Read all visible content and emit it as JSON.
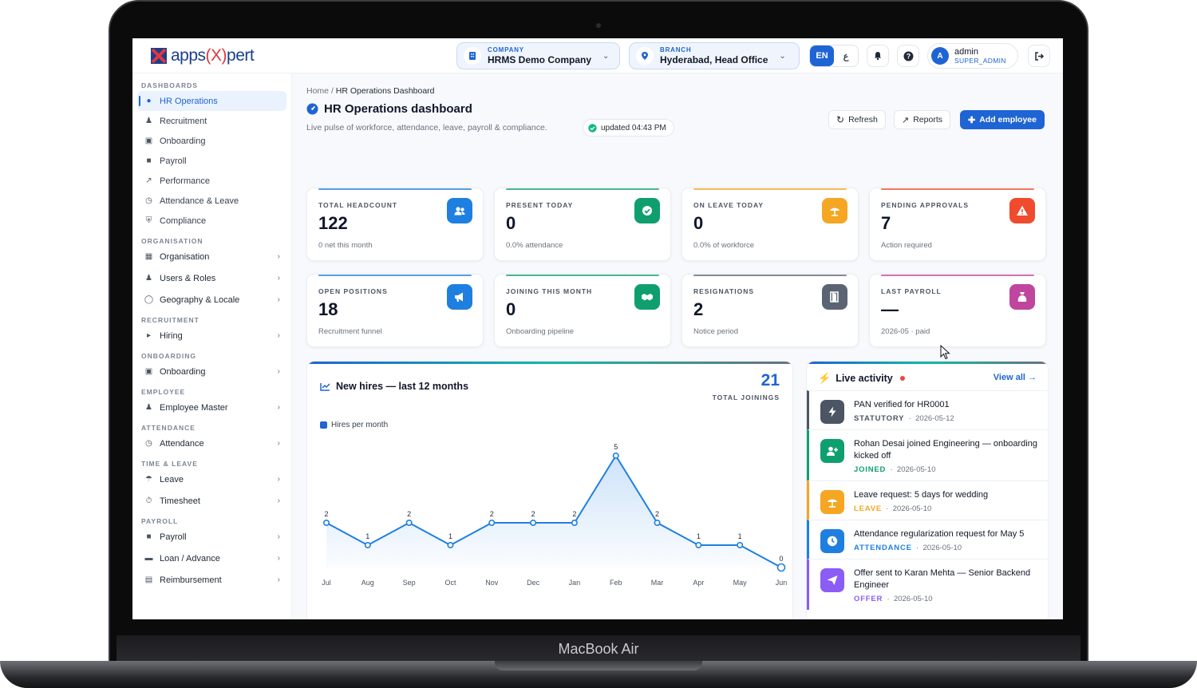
{
  "device": {
    "label": "MacBook Air"
  },
  "header": {
    "logo": {
      "prefix": "apps",
      "mark": "(X)",
      "suffix": "pert"
    },
    "company": {
      "caption": "COMPANY",
      "value": "HRMS Demo Company"
    },
    "branch": {
      "caption": "BRANCH",
      "value": "Hyderabad, Head Office"
    },
    "lang": {
      "active": "EN",
      "other": "ع"
    },
    "user": {
      "initial": "A",
      "name": "admin",
      "role": "SUPER_ADMIN"
    }
  },
  "sidebar": {
    "dashboards": {
      "title": "DASHBOARDS",
      "items": [
        "HR Operations",
        "Recruitment",
        "Onboarding",
        "Payroll",
        "Performance",
        "Attendance & Leave",
        "Compliance"
      ]
    },
    "organisation": {
      "title": "ORGANISATION",
      "items": [
        "Organisation",
        "Users & Roles",
        "Geography & Locale"
      ]
    },
    "recruitment": {
      "title": "RECRUITMENT",
      "items": [
        "Hiring"
      ]
    },
    "onboarding": {
      "title": "ONBOARDING",
      "items": [
        "Onboarding"
      ]
    },
    "employee": {
      "title": "EMPLOYEE",
      "items": [
        "Employee Master"
      ]
    },
    "attendance": {
      "title": "ATTENDANCE",
      "items": [
        "Attendance"
      ]
    },
    "time_leave": {
      "title": "TIME & LEAVE",
      "items": [
        "Leave",
        "Timesheet"
      ]
    },
    "payroll": {
      "title": "PAYROLL",
      "items": [
        "Payroll",
        "Loan / Advance",
        "Reimbursement"
      ]
    }
  },
  "main": {
    "breadcrumb": {
      "home": "Home",
      "sep": "/",
      "current": "HR Operations Dashboard"
    },
    "title": "HR Operations dashboard",
    "subtitle": "Live pulse of workforce, attendance, leave, payroll & compliance.",
    "updated": "updated 04:43 PM",
    "buttons": {
      "refresh": "Refresh",
      "reports": "Reports",
      "add": "Add employee"
    },
    "kpis": [
      {
        "label": "TOTAL HEADCOUNT",
        "value": "122",
        "sub": "0 net this month",
        "icon": "users-icon",
        "color": "#1f7fe0"
      },
      {
        "label": "PRESENT TODAY",
        "value": "0",
        "sub": "0.0% attendance",
        "icon": "check-circle-icon",
        "color": "#0f9f6e"
      },
      {
        "label": "ON LEAVE TODAY",
        "value": "0",
        "sub": "0.0% of workforce",
        "icon": "umbrella-beach-icon",
        "color": "#f5a623"
      },
      {
        "label": "PENDING APPROVALS",
        "value": "7",
        "sub": "Action required",
        "icon": "warning-icon",
        "color": "#f04b2e"
      },
      {
        "label": "OPEN POSITIONS",
        "value": "18",
        "sub": "Recruitment funnel",
        "icon": "megaphone-icon",
        "color": "#1f7fe0"
      },
      {
        "label": "JOINING THIS MONTH",
        "value": "0",
        "sub": "Onboarding pipeline",
        "icon": "handshake-icon",
        "color": "#0f9f6e"
      },
      {
        "label": "RESIGNATIONS",
        "value": "2",
        "sub": "Notice period",
        "icon": "door-exit-icon",
        "color": "#5b6472"
      },
      {
        "label": "LAST PAYROLL",
        "value": "—",
        "sub": "2026-05 · paid",
        "icon": "money-bag-icon",
        "color": "#c0459e"
      }
    ],
    "chart": {
      "title": "New hires — last 12 months",
      "total": "21",
      "total_label": "TOTAL JOININGS",
      "legend": "Hires per month"
    },
    "activity": {
      "title": "Live activity",
      "view_all": "View all →",
      "items": [
        {
          "text": "PAN verified for HR0001",
          "tag": "STATUTORY",
          "date": "2026-05-12",
          "icon": "bolt-icon",
          "color": "#4b5563"
        },
        {
          "text": "Rohan Desai joined Engineering — onboarding kicked off",
          "tag": "JOINED",
          "date": "2026-05-10",
          "icon": "user-plus-icon",
          "color": "#0f9f6e"
        },
        {
          "text": "Leave request: 5 days for wedding",
          "tag": "LEAVE",
          "date": "2026-05-10",
          "icon": "umbrella-beach-icon",
          "color": "#f5a623"
        },
        {
          "text": "Attendance regularization request for May 5",
          "tag": "ATTENDANCE",
          "date": "2026-05-10",
          "icon": "clock-icon",
          "color": "#1f7fe0"
        },
        {
          "text": "Offer sent to Karan Mehta — Senior Backend Engineer",
          "tag": "OFFER",
          "date": "2026-05-10",
          "icon": "paper-plane-icon",
          "color": "#8b5cf6"
        }
      ]
    }
  },
  "chart_data": {
    "type": "line",
    "title": "New hires — last 12 months",
    "categories": [
      "Jul",
      "Aug",
      "Sep",
      "Oct",
      "Nov",
      "Dec",
      "Jan",
      "Feb",
      "Mar",
      "Apr",
      "May",
      "Jun"
    ],
    "series": [
      {
        "name": "Hires per month",
        "values": [
          2,
          1,
          2,
          1,
          2,
          2,
          2,
          5,
          2,
          1,
          1,
          0
        ]
      }
    ],
    "ylim": [
      0,
      5
    ],
    "grid": false,
    "legend": "top-left",
    "colors": {
      "line": "#1f7fe0"
    }
  }
}
